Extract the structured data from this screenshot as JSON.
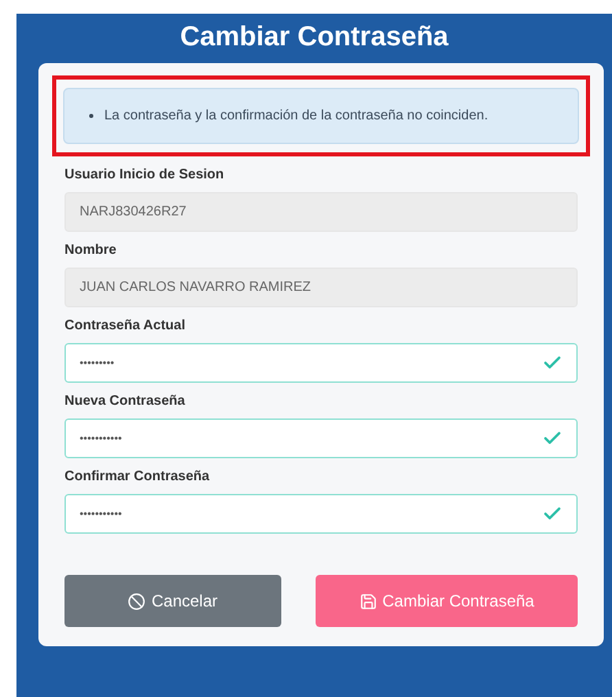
{
  "title": "Cambiar Contraseña",
  "alert": {
    "messages": [
      "La contraseña y la confirmación de la contraseña no coinciden."
    ],
    "highlighted": true
  },
  "fields": [
    {
      "label": "Usuario Inicio de Sesion",
      "value": "NARJ830426R27",
      "kind": "readonly",
      "valid": false
    },
    {
      "label": "Nombre",
      "value": "JUAN CARLOS NAVARRO RAMIREZ",
      "kind": "readonly",
      "valid": false
    },
    {
      "label": "Contraseña Actual",
      "value": "•••••••••",
      "kind": "password",
      "valid": true
    },
    {
      "label": "Nueva Contraseña",
      "value": "•••••••••••",
      "kind": "password",
      "valid": true
    },
    {
      "label": "Confirmar Contraseña",
      "value": "•••••••••••",
      "kind": "password",
      "valid": true
    }
  ],
  "buttons": [
    {
      "label": "Cancelar",
      "kind": "cancel"
    },
    {
      "label": "Cambiar Contraseña",
      "kind": "submit"
    }
  ]
}
